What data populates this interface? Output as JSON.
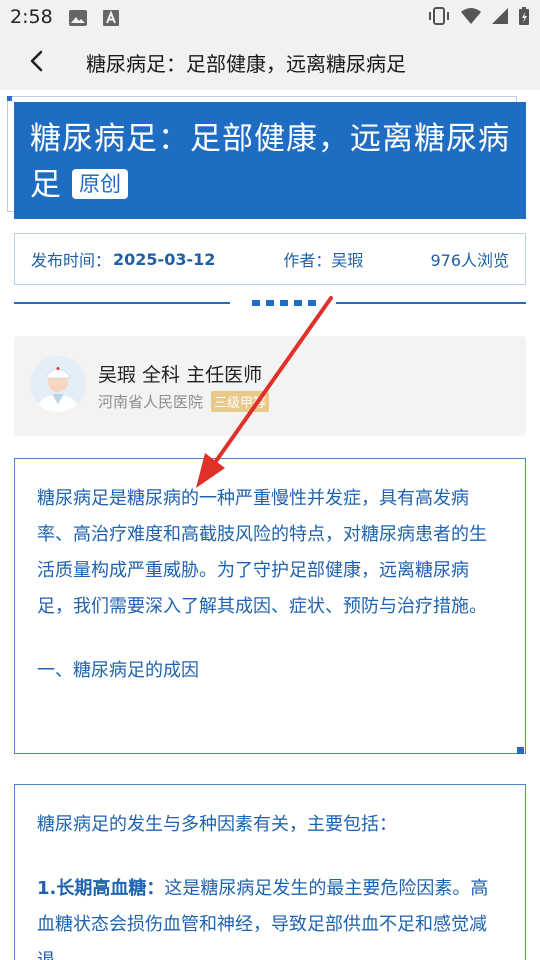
{
  "status_bar": {
    "time": "2:58",
    "icons": [
      "image-icon",
      "text-a-icon",
      "vibrate-icon",
      "wifi-icon",
      "signal-icon",
      "battery-charging-icon"
    ]
  },
  "app_bar": {
    "back_icon": "chevron-left-icon",
    "title": "糖尿病足：足部健康，远离糖尿病足"
  },
  "article": {
    "title": "糖尿病足：足部健康，远离糖尿病足",
    "badge": "原创",
    "meta": {
      "date_label": "发布时间：",
      "date": "2025-03-12",
      "author": "作者：吴瑕",
      "views": "976人浏览"
    },
    "author_card": {
      "avatar_icon": "doctor-avatar-icon",
      "name_line": "吴瑕 全科 主任医师",
      "hospital": "河南省人民医院",
      "hospital_badge": "三级甲等"
    },
    "section1": {
      "paragraph": "糖尿病足是糖尿病的一种严重慢性并发症，具有高发病率、高治疗难度和高截肢风险的特点，对糖尿病患者的生活质量构成严重威胁。为了守护足部健康，远离糖尿病足，我们需要深入了解其成因、症状、预防与治疗措施。",
      "heading": "一、糖尿病足的成因"
    },
    "section2": {
      "intro": "糖尿病足的发生与多种因素有关，主要包括：",
      "item1_title": "1.长期高血糖：",
      "item1_text": "这是糖尿病足发生的最主要危险因素。高血糖状态会损伤血管和神经，导致足部供血不足和感觉减退。"
    }
  },
  "colors": {
    "brand_blue": "#1f6dc3",
    "text_blue": "#1f63b0",
    "annotation_red": "#e0302a",
    "badge_gold": "#e8c98a"
  }
}
